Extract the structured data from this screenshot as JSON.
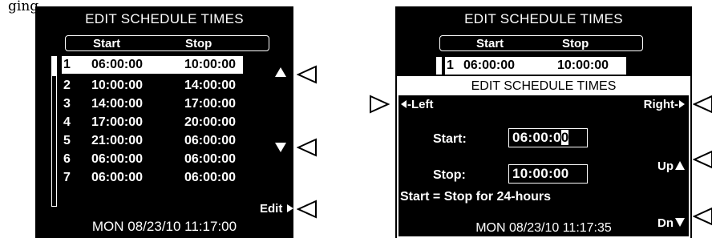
{
  "caption": "ging..",
  "left_screen": {
    "title": "EDIT SCHEDULE TIMES",
    "header": {
      "start": "Start",
      "stop": "Stop"
    },
    "rows": [
      {
        "num": "1",
        "start": "06:00:00",
        "stop": "10:00:00",
        "selected": true
      },
      {
        "num": "2",
        "start": "10:00:00",
        "stop": "14:00:00"
      },
      {
        "num": "3",
        "start": "14:00:00",
        "stop": "17:00:00"
      },
      {
        "num": "4",
        "start": "17:00:00",
        "stop": "20:00:00"
      },
      {
        "num": "5",
        "start": "21:00:00",
        "stop": "06:00:00"
      },
      {
        "num": "6",
        "start": "06:00:00",
        "stop": "06:00:00"
      },
      {
        "num": "7",
        "start": "06:00:00",
        "stop": "06:00:00"
      }
    ],
    "footer": "MON 08/23/10 11:17:00",
    "softkeys": {
      "up": "▲",
      "down": "▼",
      "edit": "Edit"
    }
  },
  "right_screen": {
    "title": "EDIT SCHEDULE TIMES",
    "header": {
      "start": "Start",
      "stop": "Stop"
    },
    "row1": {
      "num": "1",
      "start": "06:00:00",
      "stop": "10:00:00"
    },
    "popup": {
      "title": "EDIT SCHEDULE TIMES",
      "left": "Left",
      "right": "Right",
      "start_label": "Start:",
      "start_value_pre": "06:00:0",
      "start_value_cursor": "0",
      "stop_label": "Stop:",
      "stop_value": "10:00:00",
      "up": "Up",
      "down": "Dn",
      "note": "Start = Stop for 24-hours"
    },
    "footer": "MON 08/23/10 11:17:35"
  }
}
